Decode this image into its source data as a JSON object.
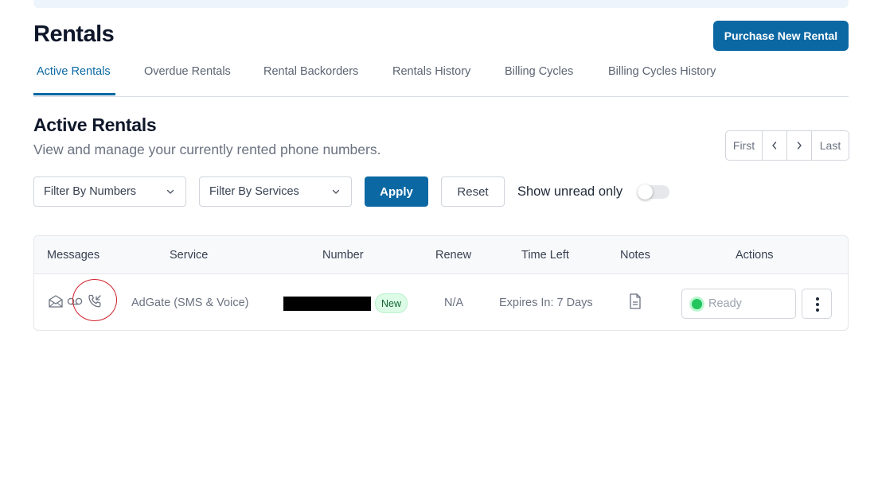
{
  "page": {
    "title": "Rentals",
    "purchase_button": "Purchase New Rental"
  },
  "tabs": [
    {
      "label": "Active Rentals",
      "active": true
    },
    {
      "label": "Overdue Rentals",
      "active": false
    },
    {
      "label": "Rental Backorders",
      "active": false
    },
    {
      "label": "Rentals History",
      "active": false
    },
    {
      "label": "Billing Cycles",
      "active": false
    },
    {
      "label": "Billing Cycles History",
      "active": false
    }
  ],
  "section": {
    "title": "Active Rentals",
    "subtitle": "View and manage your currently rented phone numbers."
  },
  "pager": {
    "first": "First",
    "prev": "‹",
    "next": "›",
    "last": "Last"
  },
  "filters": {
    "numbers": "Filter By Numbers",
    "services": "Filter By Services",
    "apply": "Apply",
    "reset": "Reset",
    "unread_label": "Show unread only",
    "unread_on": false
  },
  "table": {
    "headers": {
      "messages": "Messages",
      "service": "Service",
      "number": "Number",
      "renew": "Renew",
      "time_left": "Time Left",
      "notes": "Notes",
      "actions": "Actions"
    },
    "rows": [
      {
        "message_icons": [
          "envelope-icon",
          "voicemail-icon",
          "incoming-call-icon"
        ],
        "service": "AdGate (SMS & Voice)",
        "number_redacted": true,
        "badge": "New",
        "renew": "N/A",
        "time_left": "Expires In: 7 Days",
        "notes_icon": "document-icon",
        "status": "Ready",
        "status_color": "#22c55e"
      }
    ]
  },
  "colors": {
    "accent": "#0b68a3",
    "annotation": "#d0212a",
    "badge_bg": "#dcfce7"
  }
}
